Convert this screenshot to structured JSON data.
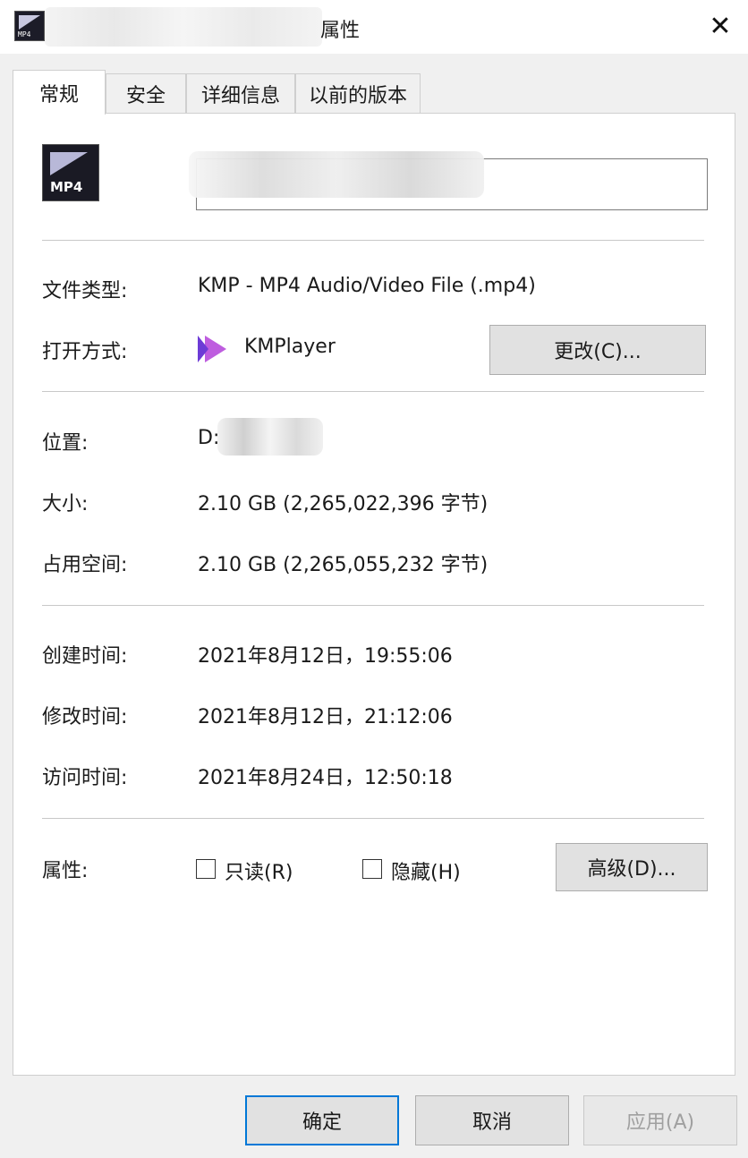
{
  "window": {
    "title": "属性",
    "close": "✕"
  },
  "tabs": [
    {
      "label": "常规"
    },
    {
      "label": "安全"
    },
    {
      "label": "详细信息"
    },
    {
      "label": "以前的版本"
    }
  ],
  "file": {
    "icon_label": "MP4"
  },
  "info": {
    "type_label": "文件类型:",
    "type_value": "KMP - MP4 Audio/Video File (.mp4)",
    "open_label": "打开方式:",
    "open_value": "KMPlayer",
    "change_button": "更改(C)...",
    "location_label": "位置:",
    "location_value": "D:",
    "size_label": "大小:",
    "size_value": "2.10 GB (2,265,022,396 字节)",
    "disk_label": "占用空间:",
    "disk_value": "2.10 GB (2,265,055,232 字节)",
    "created_label": "创建时间:",
    "created_value": "2021年8月12日，19:55:06",
    "modified_label": "修改时间:",
    "modified_value": "2021年8月12日，21:12:06",
    "accessed_label": "访问时间:",
    "accessed_value": "2021年8月24日，12:50:18",
    "attrs_label": "属性:",
    "readonly_label": "只读(R)",
    "hidden_label": "隐藏(H)",
    "advanced_button": "高级(D)..."
  },
  "footer": {
    "ok": "确定",
    "cancel": "取消",
    "apply": "应用(A)"
  },
  "colors": {
    "accent": "#0078d7",
    "kmplayer_purple": "#8b45d8"
  }
}
